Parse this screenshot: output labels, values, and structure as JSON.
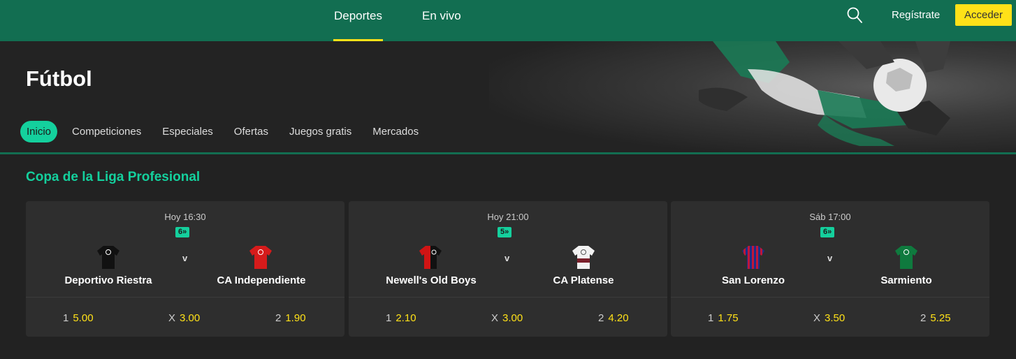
{
  "topnav": {
    "items": [
      {
        "label": "Deportes",
        "active": true
      },
      {
        "label": "En vivo",
        "active": false
      }
    ],
    "search_icon": "search-icon",
    "register_label": "Regístrate",
    "login_label": "Acceder"
  },
  "hero": {
    "title": "Fútbol",
    "tabs": [
      {
        "label": "Inicio",
        "active": true
      },
      {
        "label": "Competiciones",
        "active": false
      },
      {
        "label": "Especiales",
        "active": false
      },
      {
        "label": "Ofertas",
        "active": false
      },
      {
        "label": "Juegos gratis",
        "active": false
      },
      {
        "label": "Mercados",
        "active": false
      }
    ]
  },
  "section": {
    "title": "Copa de la Liga Profesional"
  },
  "matches": [
    {
      "time": "Hoy 16:30",
      "markets": "6»",
      "home": {
        "name": "Deportivo Riestra",
        "jersey": "black"
      },
      "away": {
        "name": "CA Independiente",
        "jersey": "red"
      },
      "vs": "v",
      "odds": [
        {
          "label": "1",
          "value": "5.00"
        },
        {
          "label": "X",
          "value": "3.00"
        },
        {
          "label": "2",
          "value": "1.90"
        }
      ]
    },
    {
      "time": "Hoy 21:00",
      "markets": "5»",
      "home": {
        "name": "Newell's Old Boys",
        "jersey": "red-black-halves"
      },
      "away": {
        "name": "CA Platense",
        "jersey": "white-maroon-band"
      },
      "vs": "v",
      "odds": [
        {
          "label": "1",
          "value": "2.10"
        },
        {
          "label": "X",
          "value": "3.00"
        },
        {
          "label": "2",
          "value": "4.20"
        }
      ]
    },
    {
      "time": "Sáb 17:00",
      "markets": "6»",
      "home": {
        "name": "San Lorenzo",
        "jersey": "blue-red-stripes"
      },
      "away": {
        "name": "Sarmiento",
        "jersey": "green"
      },
      "vs": "v",
      "odds": [
        {
          "label": "1",
          "value": "1.75"
        },
        {
          "label": "X",
          "value": "3.50"
        },
        {
          "label": "2",
          "value": "5.25"
        }
      ]
    }
  ],
  "colors": {
    "brand_green": "#126E51",
    "accent_mint": "#14D09D",
    "accent_yellow": "#FFE118",
    "background": "#222222",
    "card": "#2e2e2e"
  }
}
